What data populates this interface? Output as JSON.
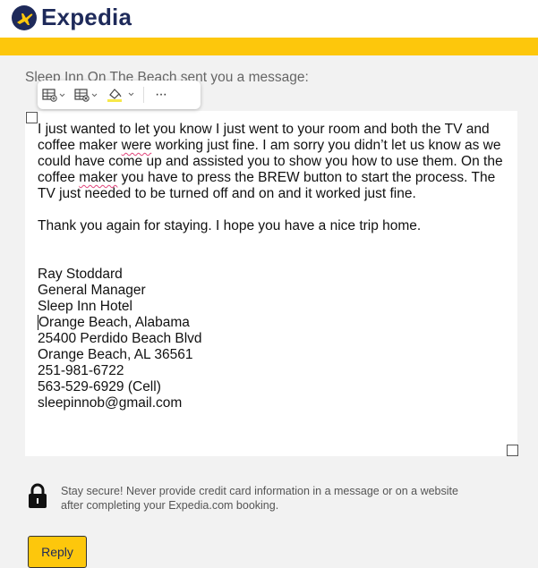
{
  "brand": {
    "name": "Expedia",
    "accent_color": "#fdc70c",
    "text_color": "#1e2a5a",
    "logo_icon": "plane-icon"
  },
  "message": {
    "subject": "Sleep Inn On The Beach sent you a message:",
    "paragraph1": {
      "part1": "I just wanted to let you know I just went to your room and both the TV and coffee maker ",
      "word1": "were",
      "part2": " working just fine.  I am sorry you didn’t let us know as we could have come up and assisted you to show you how to use them.  On the coffee ",
      "word2": "maker",
      "part3": " you have to press the BREW button to start the process.  The TV just needed to be turned off and on and it worked just fine."
    },
    "paragraph2": "Thank you again for staying.  I hope you have a nice trip home.",
    "signature": [
      "Ray Stoddard",
      "General Manager",
      "Sleep Inn Hotel",
      "Orange Beach, Alabama",
      "25400 Perdido Beach Blvd",
      "Orange Beach, AL 36561",
      "251-981-6722",
      "563-529-6929 (Cell)",
      "sleepinnob@gmail.com"
    ]
  },
  "toolbar": {
    "icons": [
      "table-insert-icon",
      "table-delete-icon",
      "highlight-color-icon",
      "more-options-icon"
    ],
    "more_label": "···"
  },
  "security": {
    "icon": "lock-icon",
    "text": "Stay secure! Never provide credit card information in a message or on a website after completing your Expedia.com booking."
  },
  "actions": {
    "reply_label": "Reply"
  }
}
